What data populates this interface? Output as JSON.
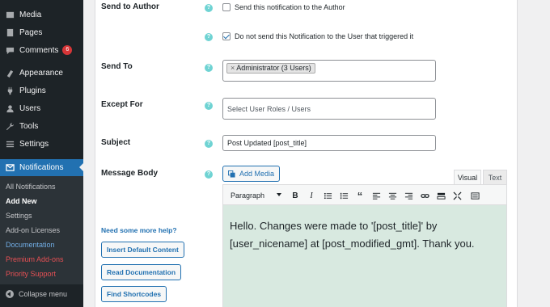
{
  "sidebar": {
    "items": [
      {
        "label": "Media",
        "icon": "media-icon"
      },
      {
        "label": "Pages",
        "icon": "pages-icon"
      },
      {
        "label": "Comments",
        "icon": "comments-icon",
        "badge": "6"
      },
      {
        "label": "Appearance",
        "icon": "appearance-icon"
      },
      {
        "label": "Plugins",
        "icon": "plugins-icon"
      },
      {
        "label": "Users",
        "icon": "users-icon"
      },
      {
        "label": "Tools",
        "icon": "tools-icon"
      },
      {
        "label": "Settings",
        "icon": "settings-icon"
      }
    ],
    "active": {
      "label": "Notifications",
      "icon": "mail-icon"
    },
    "submenu": [
      "All Notifications",
      "Add New",
      "Settings",
      "Add-on Licenses",
      "Documentation",
      "Premium Add-ons",
      "Priority Support"
    ],
    "collapse_label": "Collapse menu"
  },
  "form": {
    "send_to_author": {
      "label": "Send to Author",
      "option1": "Send this notification to the Author",
      "option1_checked": false,
      "option2": "Do not send this Notification to the User that triggered it",
      "option2_checked": true
    },
    "send_to": {
      "label": "Send To",
      "token_remove": "×",
      "token": "Administrator (3 Users)"
    },
    "except_for": {
      "label": "Except For",
      "placeholder": "Select User Roles / Users"
    },
    "subject": {
      "label": "Subject",
      "value": "Post Updated [post_title]"
    },
    "message_body": {
      "label": "Message Body",
      "help_link": "Need some more help?",
      "buttons": [
        "Insert Default Content",
        "Read Documentation",
        "Find Shortcodes"
      ]
    },
    "help_icon": "?"
  },
  "editor": {
    "add_media": "Add Media",
    "tabs": {
      "visual": "Visual",
      "text": "Text"
    },
    "format": "Paragraph",
    "content": "Hello. Changes were made to '[post_title]' by [user_nicename] at [post_modified_gmt]. Thank you."
  },
  "colors": {
    "sidebar_bg": "#1d2327",
    "active": "#2271b1",
    "help_icon": "#6fd3d3",
    "editor_bg": "#d8e9e0"
  }
}
